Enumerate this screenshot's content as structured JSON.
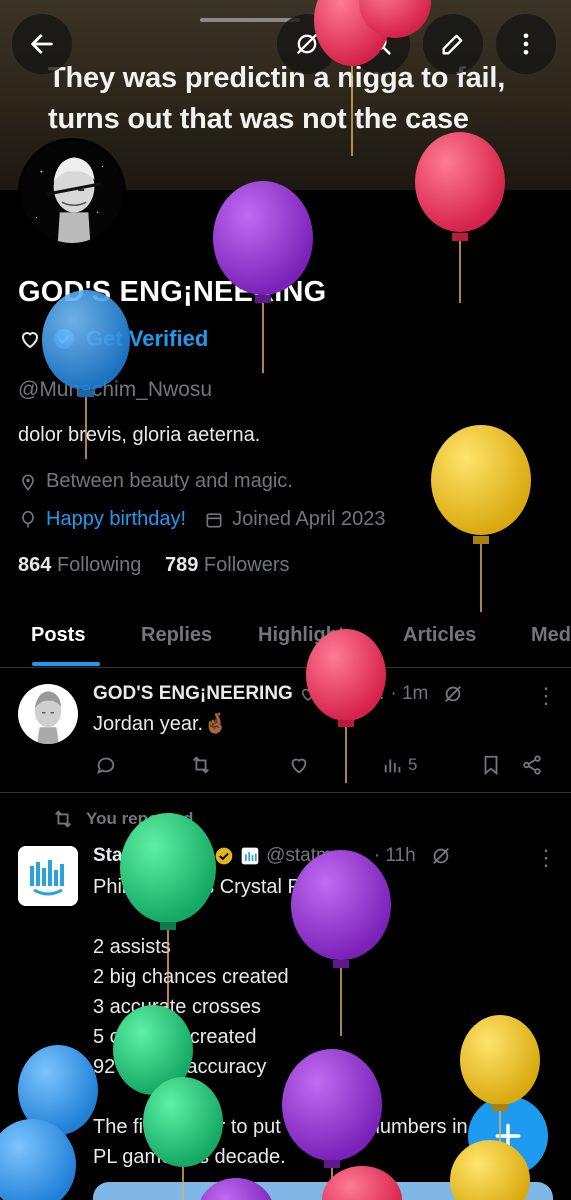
{
  "banner": {
    "text": "They was predictin a nigga to fail, turns out that was not the case"
  },
  "profile": {
    "name": "GOD'S ENG¡NEERING",
    "get_verified": "Get Verified",
    "handle": "@Munachim_Nwosu",
    "bio": "dolor brevis, gloria aeterna.",
    "location": "Between beauty and magic.",
    "birthday": "Happy birthday!",
    "joined": "Joined April 2023",
    "following_count": "864",
    "following_label": "Following",
    "followers_count": "789",
    "followers_label": "Followers"
  },
  "tabs": [
    "Posts",
    "Replies",
    "Highlights",
    "Articles",
    "Media"
  ],
  "posts": [
    {
      "name": "GOD'S ENG¡NEERING",
      "handle": "@Mu...",
      "time": "· 1m",
      "text": "Jordan year.🤞🏾",
      "views": "5"
    },
    {
      "repost_label": "You reposted",
      "name": "StatMuse FC",
      "handle": "@statmus...",
      "time": "· 11h",
      "text": "Phil Foden vs Crystal Palace:\n\n2 assists\n2 big chances created\n3 accurate crosses\n5 chances created\n92% pass accuracy\n\nThe first player to put up those numbers in a\nPL game this decade."
    }
  ],
  "colors": {
    "accent": "#1d9bf0",
    "muted": "#71767b",
    "background": "#000000"
  },
  "icons": [
    "back-arrow-icon",
    "hide-icon",
    "search-icon",
    "edit-icon",
    "more-vertical-icon",
    "heart-icon",
    "verified-badge-icon",
    "location-icon",
    "balloon-icon",
    "calendar-icon",
    "reply-icon",
    "repost-icon",
    "like-icon",
    "views-icon",
    "bookmark-icon",
    "share-icon",
    "compose-plus-icon"
  ]
}
